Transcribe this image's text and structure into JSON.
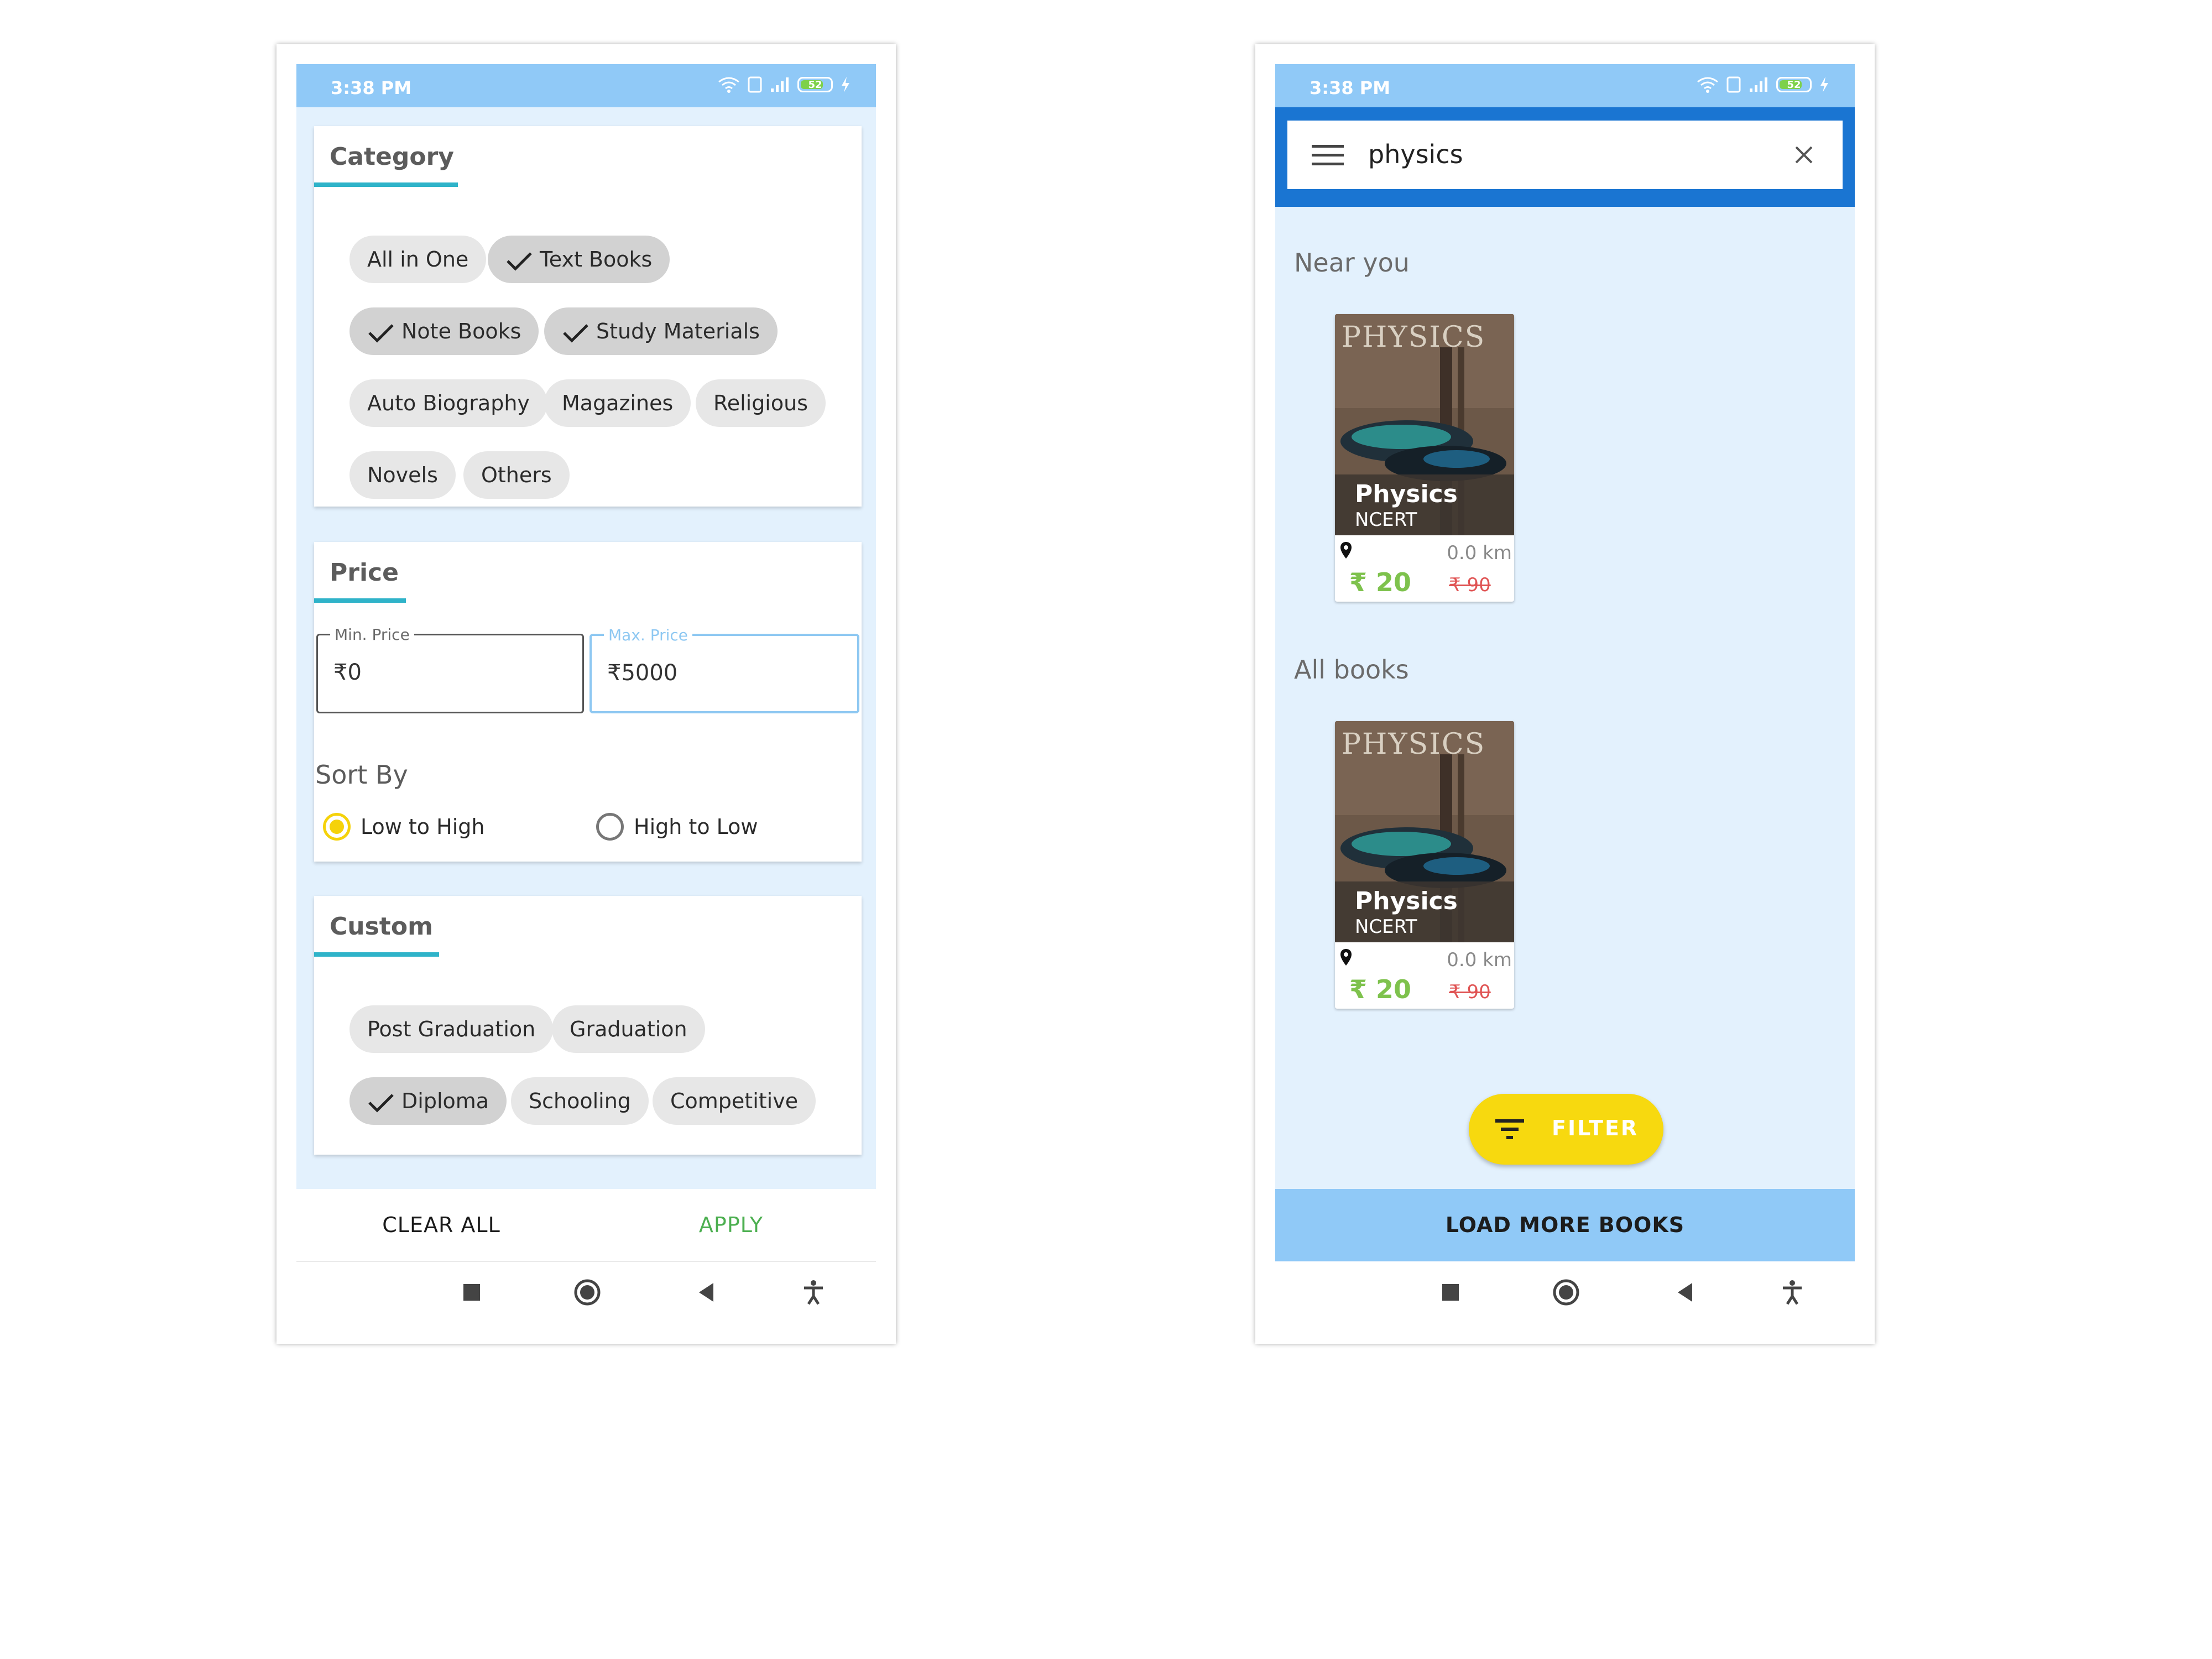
{
  "status_bar": {
    "time": "3:38 PM",
    "battery": "52"
  },
  "filter_screen": {
    "category": {
      "title": "Category",
      "chips": [
        {
          "label": "All in One",
          "selected": false
        },
        {
          "label": "Text Books",
          "selected": true
        },
        {
          "label": "Note Books",
          "selected": true
        },
        {
          "label": "Study Materials",
          "selected": true
        },
        {
          "label": "Auto Biography",
          "selected": false
        },
        {
          "label": "Magazines",
          "selected": false
        },
        {
          "label": "Religious",
          "selected": false
        },
        {
          "label": "Novels",
          "selected": false
        },
        {
          "label": "Others",
          "selected": false
        }
      ]
    },
    "price": {
      "title": "Price",
      "min_label": "Min. Price",
      "min_value": "₹0",
      "max_label": "Max. Price",
      "max_value": "₹5000"
    },
    "sort": {
      "title": "Sort By",
      "options": [
        {
          "label": "Low to High",
          "selected": true
        },
        {
          "label": "High to Low",
          "selected": false
        }
      ]
    },
    "custom": {
      "title": "Custom",
      "chips": [
        {
          "label": "Post Graduation",
          "selected": false
        },
        {
          "label": "Graduation",
          "selected": false
        },
        {
          "label": "Diploma",
          "selected": true
        },
        {
          "label": "Schooling",
          "selected": false
        },
        {
          "label": "Competitive",
          "selected": false
        }
      ]
    },
    "actions": {
      "clear_all": "CLEAR ALL",
      "apply": "APPLY"
    }
  },
  "search_screen": {
    "search": {
      "query": "physics"
    },
    "sections": [
      {
        "title": "Near you"
      },
      {
        "title": "All books"
      }
    ],
    "books": [
      {
        "cover_text": "PHYSICS",
        "name": "Physics",
        "author": "NCERT",
        "distance": "0.0 km",
        "price": "₹ 20",
        "mrp": "₹ 90"
      },
      {
        "cover_text": "PHYSICS",
        "name": "Physics",
        "author": "NCERT",
        "distance": "0.0 km",
        "price": "₹ 20",
        "mrp": "₹ 90"
      }
    ],
    "fab_label": "FILTER",
    "load_more": "LOAD MORE BOOKS"
  },
  "colors": {
    "accent_blue": "#1a75d2",
    "status_blue": "#90c9f7",
    "fab_yellow": "#f7d90f",
    "apply_green": "#4caf50",
    "underline_teal": "#2fb3c9"
  }
}
